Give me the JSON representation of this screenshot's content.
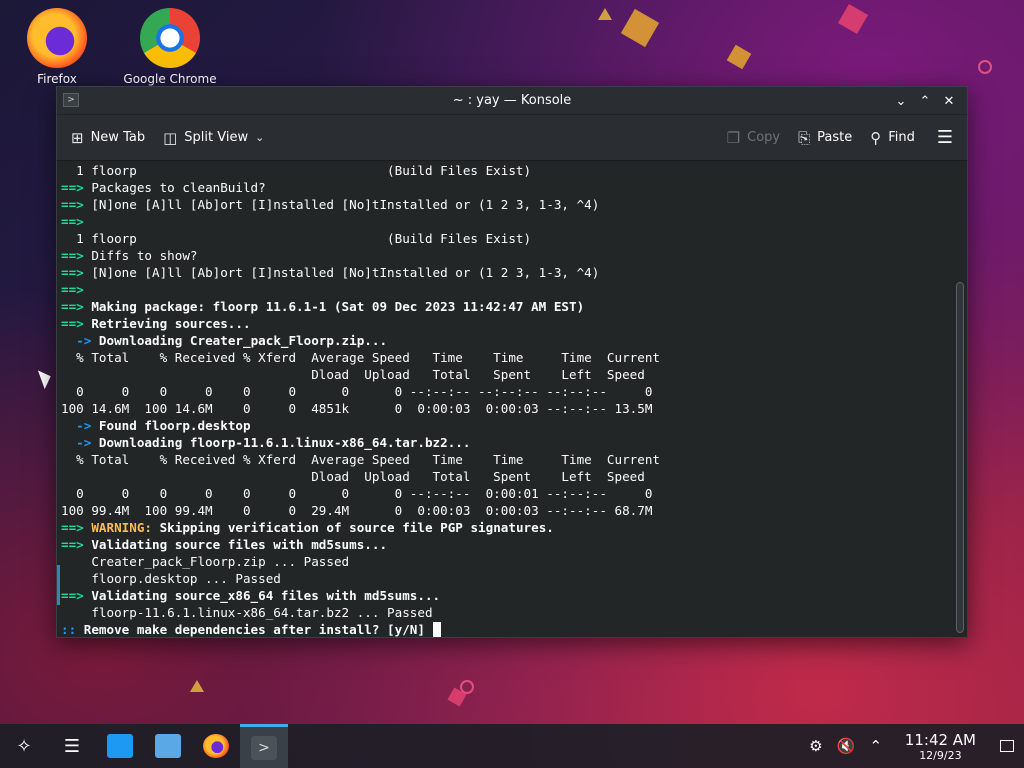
{
  "desktop": {
    "icons": [
      {
        "label": "Firefox",
        "icon": "firefox-icon"
      },
      {
        "label": "Google Chrome",
        "icon": "chrome-icon"
      }
    ]
  },
  "window": {
    "title": "~ : yay — Konsole",
    "toolbar": {
      "new_tab": "New Tab",
      "split_view": "Split View",
      "copy": "Copy",
      "paste": "Paste",
      "find": "Find"
    }
  },
  "terminal": {
    "lines": [
      "  1 floorp                                 (Build Files Exist)",
      "==> Packages to cleanBuild?",
      "==> [N]one [A]ll [Ab]ort [I]nstalled [No]tInstalled or (1 2 3, 1-3, ^4)",
      "==>",
      "  1 floorp                                 (Build Files Exist)",
      "==> Diffs to show?",
      "==> [N]one [A]ll [Ab]ort [I]nstalled [No]tInstalled or (1 2 3, 1-3, ^4)",
      "==>",
      "==> Making package: floorp 11.6.1-1 (Sat 09 Dec 2023 11:42:47 AM EST)",
      "==> Retrieving sources...",
      "  -> Downloading Creater_pack_Floorp.zip...",
      "  % Total    % Received % Xferd  Average Speed   Time    Time     Time  Current",
      "                                 Dload  Upload   Total   Spent    Left  Speed",
      "  0     0    0     0    0     0      0      0 --:--:-- --:--:-- --:--:--     0",
      "100 14.6M  100 14.6M    0     0  4851k      0  0:00:03  0:00:03 --:--:-- 13.5M",
      "  -> Found floorp.desktop",
      "  -> Downloading floorp-11.6.1.linux-x86_64.tar.bz2...",
      "  % Total    % Received % Xferd  Average Speed   Time    Time     Time  Current",
      "                                 Dload  Upload   Total   Spent    Left  Speed",
      "  0     0    0     0    0     0      0      0 --:--:--  0:00:01 --:--:--     0",
      "100 99.4M  100 99.4M    0     0  29.4M      0  0:00:03  0:00:03 --:--:-- 68.7M",
      "==> WARNING: Skipping verification of source file PGP signatures.",
      "==> Validating source files with md5sums...",
      "    Creater_pack_Floorp.zip ... Passed",
      "    floorp.desktop ... Passed",
      "==> Validating source_x86_64 files with md5sums...",
      "    floorp-11.6.1.linux-x86_64.tar.bz2 ... Passed",
      ":: Remove make dependencies after install? [y/N] "
    ]
  },
  "taskbar": {
    "clock_time": "11:42 AM",
    "clock_date": "12/9/23"
  },
  "colors": {
    "accent": "#3daee9",
    "prompt_green": "#1cdc9a",
    "warning_yellow": "#fdbc4b",
    "terminal_bg": "#232627"
  }
}
